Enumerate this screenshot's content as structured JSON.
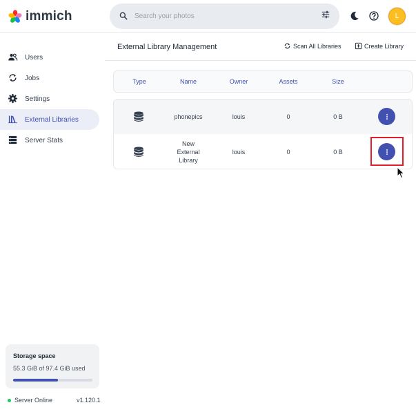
{
  "app": {
    "name": "immich"
  },
  "header": {
    "search_placeholder": "Search your photos",
    "avatar_initial": "L"
  },
  "sidebar": {
    "items": [
      {
        "label": "Users",
        "icon": "users-icon"
      },
      {
        "label": "Jobs",
        "icon": "sync-icon"
      },
      {
        "label": "Settings",
        "icon": "gear-icon"
      },
      {
        "label": "External Libraries",
        "icon": "library-icon",
        "active": true
      },
      {
        "label": "Server Stats",
        "icon": "server-icon"
      }
    ],
    "storage": {
      "title": "Storage space",
      "used_text": "55.3 GiB of 97.4 GiB used",
      "used_fraction": 0.568
    },
    "server_status": "Server Online",
    "version": "v1.120.1"
  },
  "main": {
    "title": "External Library Management",
    "actions": {
      "scan_all": "Scan All Libraries",
      "create": "Create Library"
    },
    "table": {
      "headers": [
        "Type",
        "Name",
        "Owner",
        "Assets",
        "Size"
      ],
      "rows": [
        {
          "name": "phonepics",
          "owner": "louis",
          "assets": "0",
          "size": "0 B"
        },
        {
          "name": "New External Library",
          "owner": "louis",
          "assets": "0",
          "size": "0 B"
        }
      ]
    }
  },
  "colors": {
    "accent": "#4250af",
    "status_online": "#22c55e",
    "avatar": "#fbbf24",
    "highlight": "#e11d2a"
  }
}
